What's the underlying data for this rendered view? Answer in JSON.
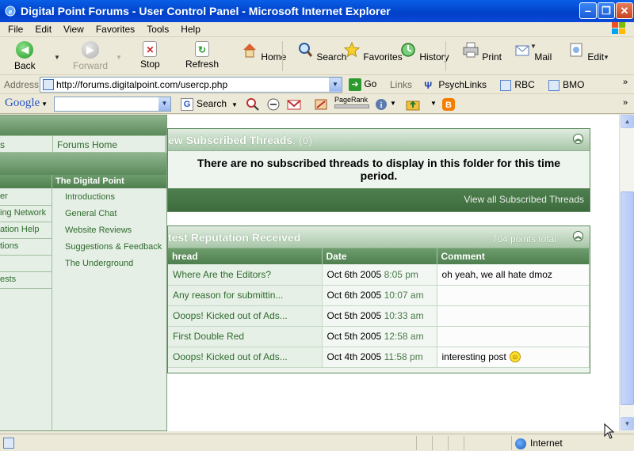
{
  "window": {
    "title": "Digital Point Forums - User Control Panel - Microsoft Internet Explorer",
    "min_label": "‒",
    "max_label": "❐",
    "close_label": "✕"
  },
  "menu": [
    "File",
    "Edit",
    "View",
    "Favorites",
    "Tools",
    "Help"
  ],
  "toolbar": {
    "back": "Back",
    "forward": "Forward",
    "stop": "Stop",
    "refresh": "Refresh",
    "home": "Home",
    "search": "Search",
    "favorites": "Favorites",
    "history": "History",
    "print": "Print",
    "mail": "Mail",
    "edit": "Edit"
  },
  "address": {
    "label": "Address",
    "url": "http://forums.digitalpoint.com/usercp.php",
    "go": "Go",
    "links_label": "Links",
    "links": [
      "PsychLinks",
      "RBC",
      "BMO"
    ]
  },
  "google": {
    "logo": "Google",
    "search_label": "Search",
    "pagerank_label": "PageRank"
  },
  "sidebar": {
    "left_top": "s",
    "forums_home": "Forums Home",
    "category_title": "The Digital Point",
    "left_items": [
      "er",
      "ing Network",
      "ation Help",
      "tions",
      "",
      "ests"
    ],
    "right_items": [
      "Introductions",
      "General Chat",
      "Website Reviews",
      "Suggestions & Feedback",
      "The Underground"
    ]
  },
  "subscribed": {
    "title": "ew Subscribed Threads",
    "count": ": (0)",
    "message": "There are no subscribed threads to display in this folder for this time period.",
    "footer_link": "View all Subscribed Threads"
  },
  "reputation": {
    "title": "test Reputation Received",
    "total": "704 points total",
    "columns": [
      "hread",
      "Date",
      "Comment"
    ],
    "rows": [
      {
        "thread": "Where Are the Editors?",
        "date": "Oct 6th 2005",
        "time": "8:05 pm",
        "comment": "oh yeah, we all hate dmoz",
        "smiley": false
      },
      {
        "thread": "Any reason for submittin...",
        "date": "Oct 6th 2005",
        "time": "10:07 am",
        "comment": "",
        "smiley": false
      },
      {
        "thread": "Ooops! Kicked out of Ads...",
        "date": "Oct 5th 2005",
        "time": "10:33 am",
        "comment": "",
        "smiley": false
      },
      {
        "thread": "First Double Red",
        "date": "Oct 5th 2005",
        "time": "12:58 am",
        "comment": "",
        "smiley": false
      },
      {
        "thread": "Ooops! Kicked out of Ads...",
        "date": "Oct 4th 2005",
        "time": "11:58 pm",
        "comment": "interesting post",
        "smiley": true
      }
    ]
  },
  "status": {
    "zone": "Internet"
  },
  "colors": {
    "titlebar": "#0a4ad8",
    "panel_green": "#4f7f4f",
    "link_green": "#2f6b2f"
  }
}
